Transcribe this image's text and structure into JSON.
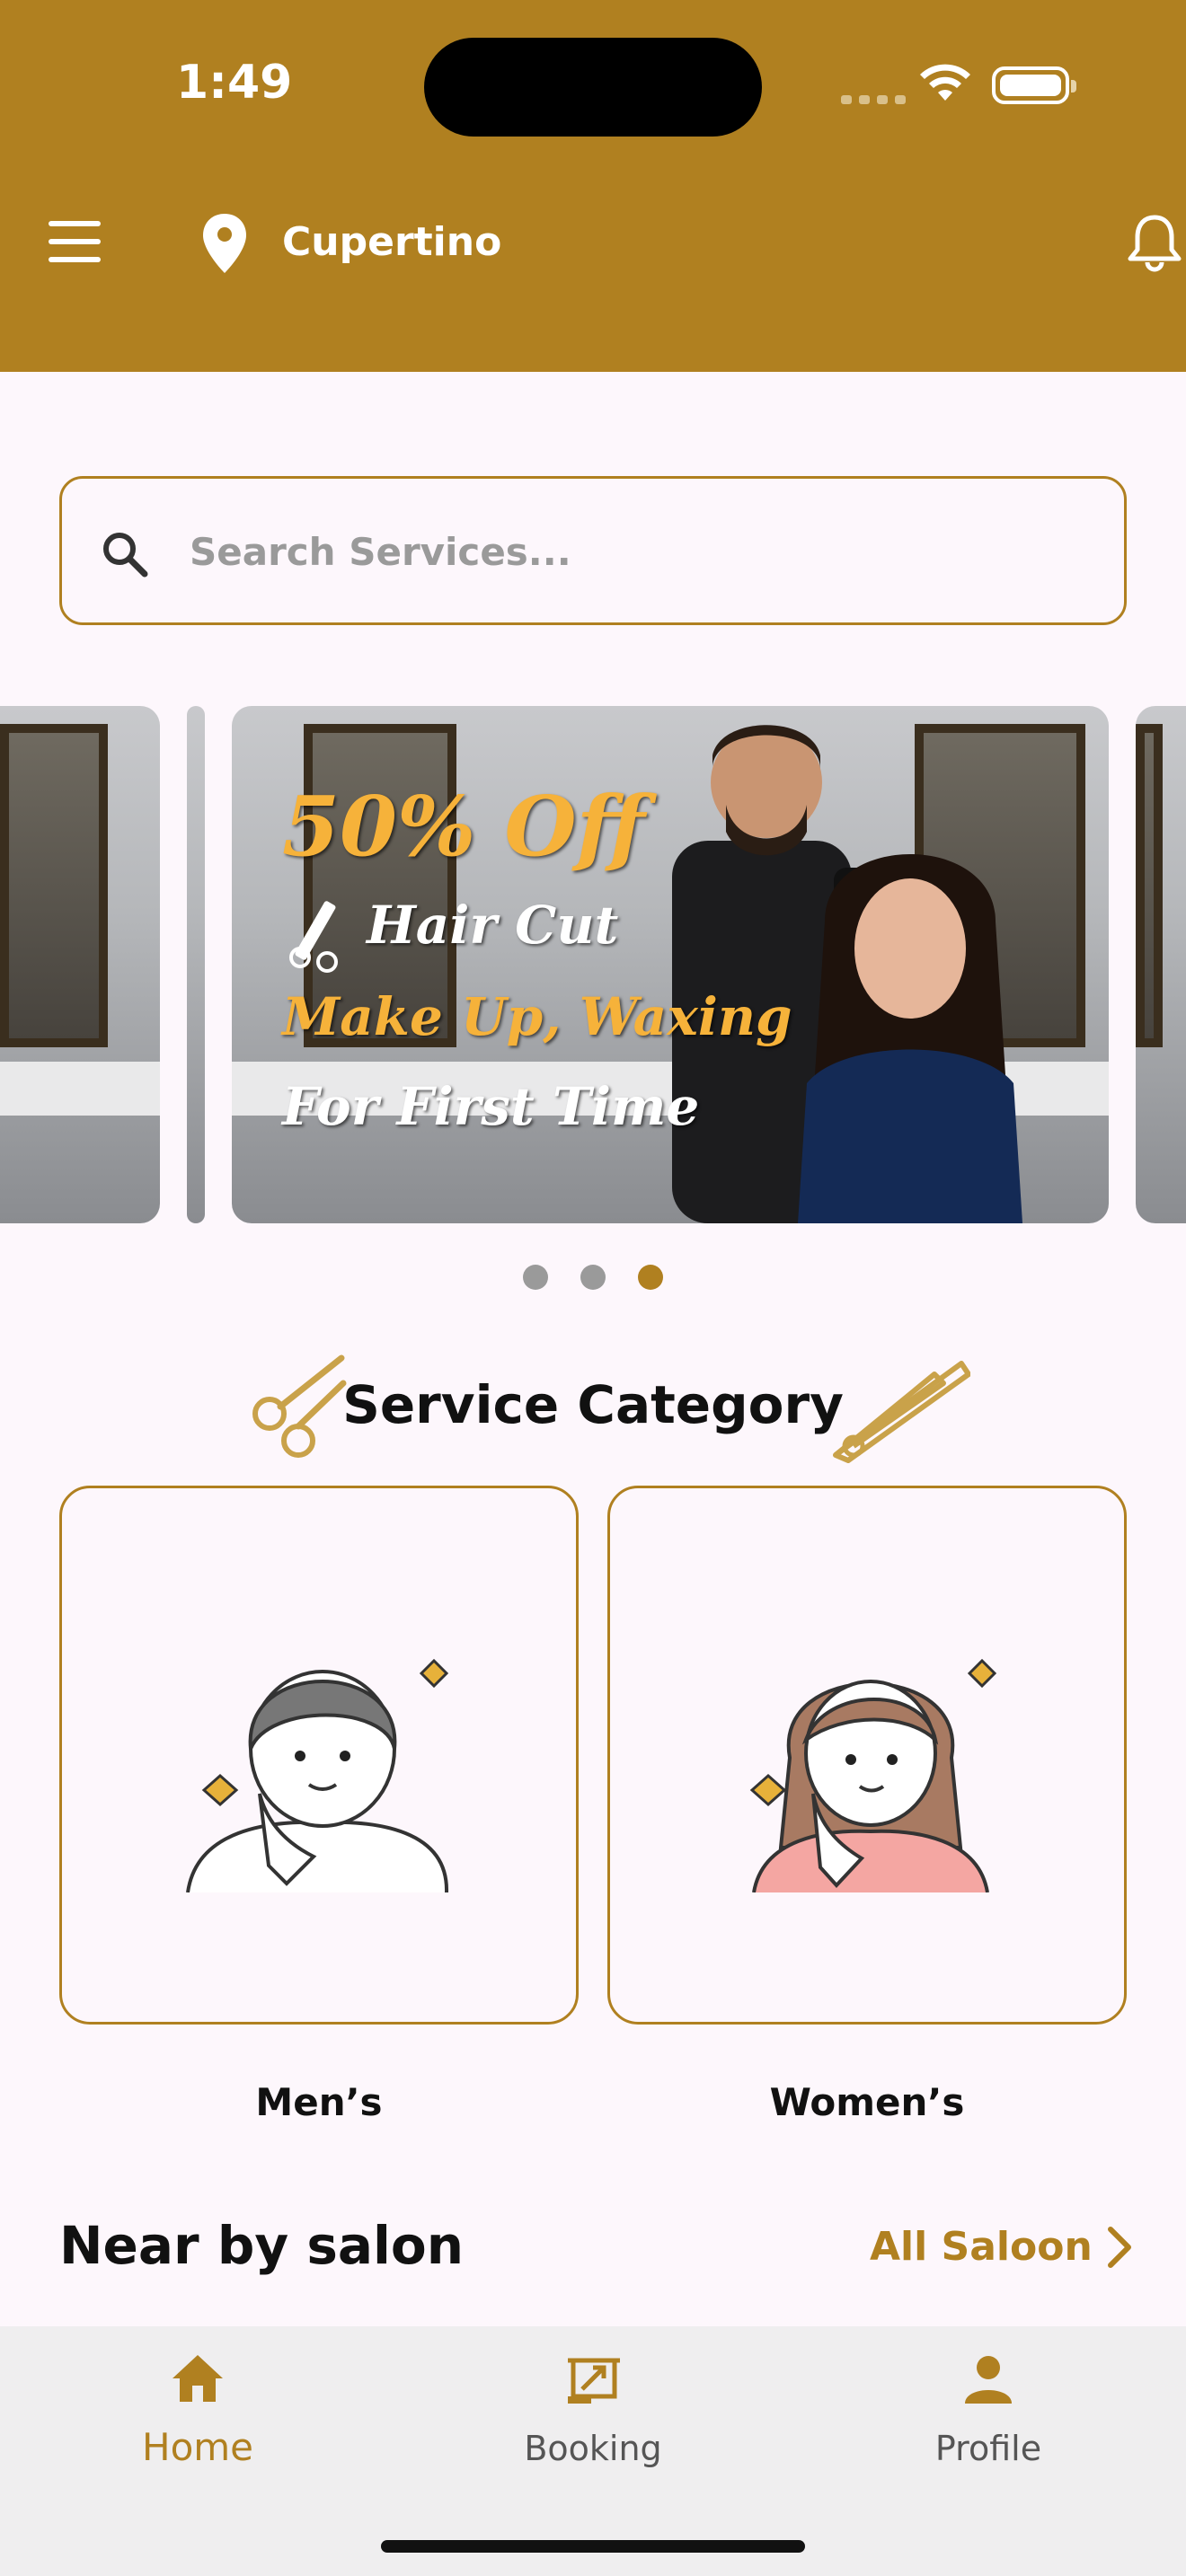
{
  "status_bar": {
    "time": "1:49"
  },
  "header": {
    "location": "Cupertino"
  },
  "search": {
    "placeholder": "Search Services..."
  },
  "carousel": {
    "promo": {
      "discount": "50% Off",
      "line1": "Hair Cut",
      "line2": "Make Up, Waxing",
      "line3": "For First Time"
    },
    "page_count": 3,
    "active_index": 2
  },
  "service_category": {
    "title": "Service Category",
    "items": [
      {
        "label": "Men’s"
      },
      {
        "label": "Women’s"
      }
    ]
  },
  "nearby": {
    "title": "Near by salon",
    "all_link": "All Saloon"
  },
  "tabbar": {
    "items": [
      {
        "label": "Home",
        "icon": "home-icon",
        "active": true
      },
      {
        "label": "Booking",
        "icon": "booking-icon",
        "active": false
      },
      {
        "label": "Profile",
        "icon": "profile-icon",
        "active": false
      }
    ]
  },
  "colors": {
    "accent": "#b08020",
    "background": "#fdf7fc",
    "tabbar": "#efeeef"
  }
}
